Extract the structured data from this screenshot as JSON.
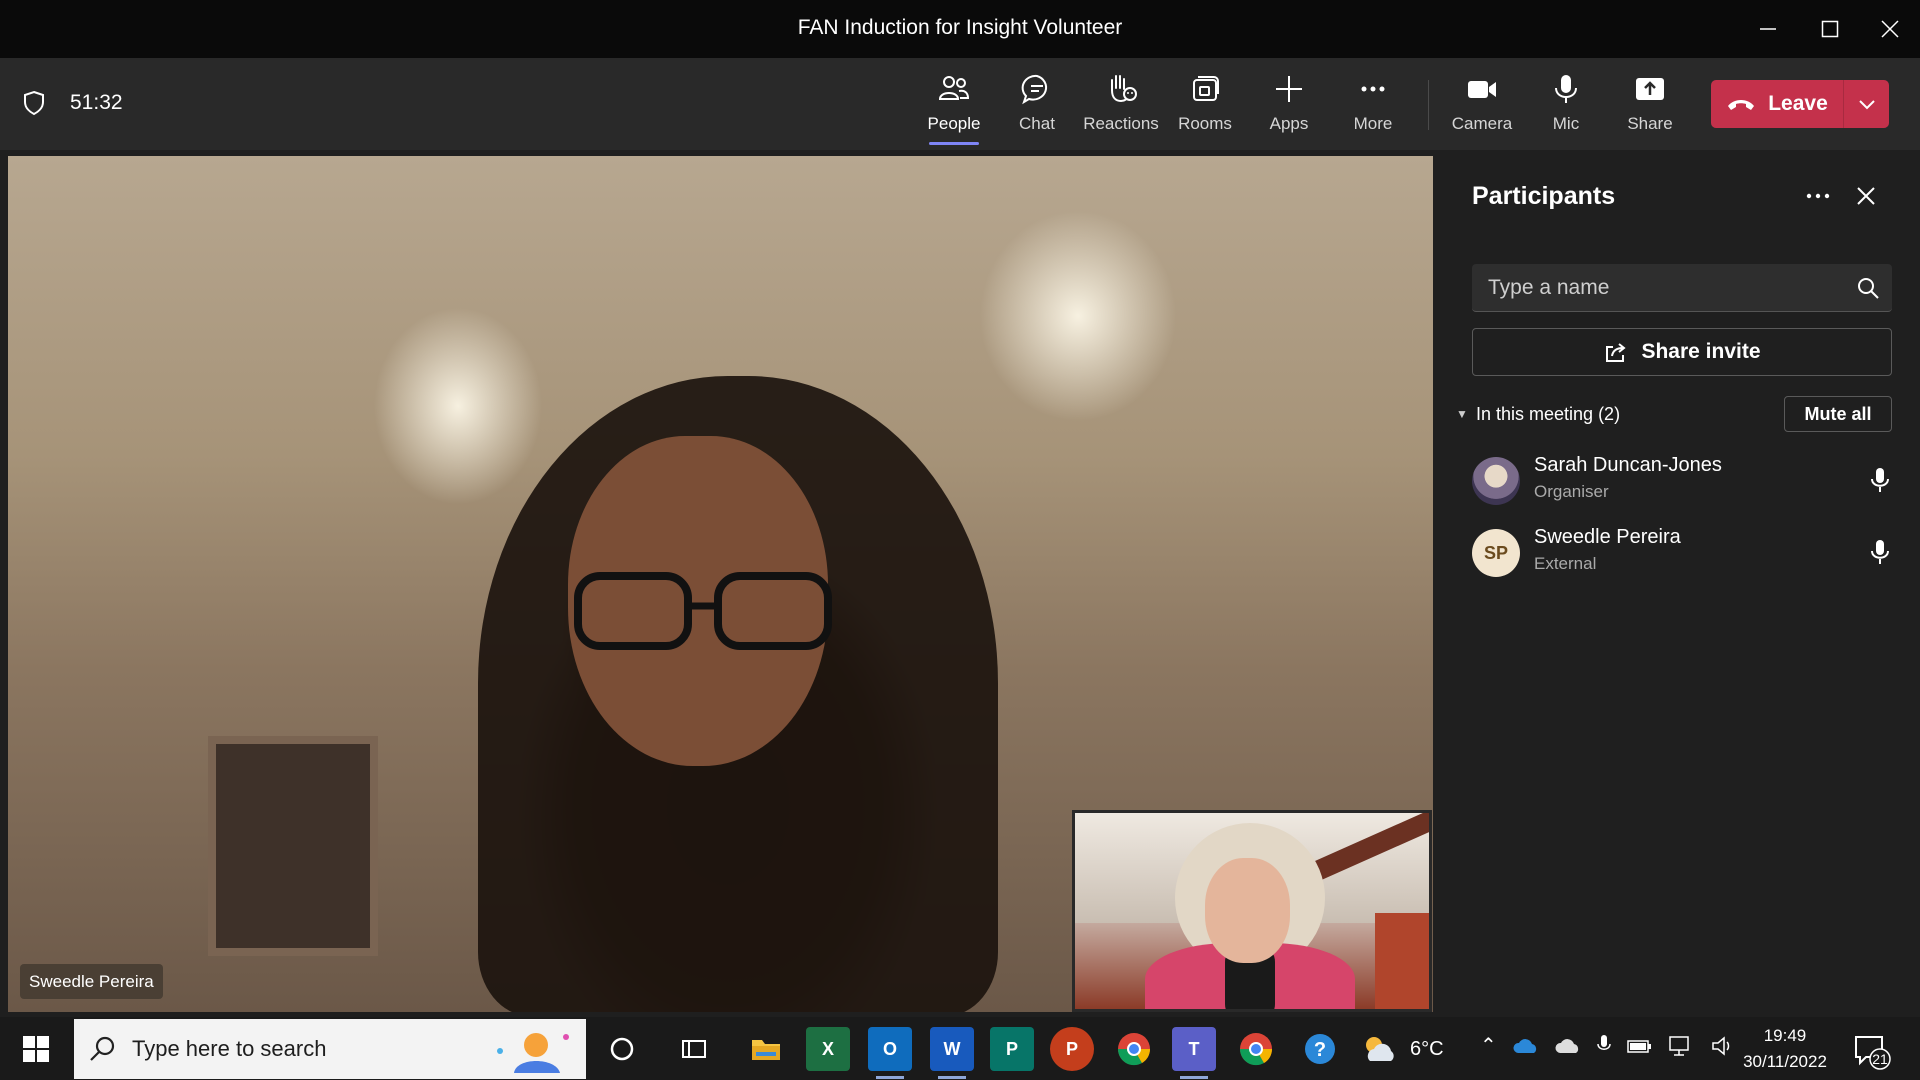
{
  "window": {
    "title": "FAN Induction for Insight Volunteer"
  },
  "toolbar": {
    "timer": "51:32",
    "buttons": [
      {
        "id": "people",
        "label": "People",
        "icon": "people-icon",
        "active": true
      },
      {
        "id": "chat",
        "label": "Chat",
        "icon": "chat-icon"
      },
      {
        "id": "reactions",
        "label": "Reactions",
        "icon": "raise-hand-icon"
      },
      {
        "id": "rooms",
        "label": "Rooms",
        "icon": "rooms-icon"
      },
      {
        "id": "apps",
        "label": "Apps",
        "icon": "plus-icon"
      },
      {
        "id": "more",
        "label": "More",
        "icon": "more-icon"
      },
      {
        "id": "camera",
        "label": "Camera",
        "icon": "camera-icon"
      },
      {
        "id": "mic",
        "label": "Mic",
        "icon": "mic-icon"
      },
      {
        "id": "share",
        "label": "Share",
        "icon": "share-tray-icon"
      }
    ],
    "leave_label": "Leave",
    "leave_color": "#c4314b"
  },
  "stage": {
    "main_name": "Sweedle Pereira"
  },
  "participants": {
    "title": "Participants",
    "search_placeholder": "Type a name",
    "share_invite": "Share invite",
    "section_label": "In this meeting (2)",
    "mute_all": "Mute all",
    "people": [
      {
        "name": "Sarah Duncan-Jones",
        "role": "Organiser",
        "avatar": "photo"
      },
      {
        "name": "Sweedle Pereira",
        "role": "External",
        "avatar": "initials",
        "initials": "SP"
      }
    ]
  },
  "taskbar": {
    "search_placeholder": "Type here to search",
    "apps": [
      {
        "name": "cortana-icon"
      },
      {
        "name": "task-view-icon"
      },
      {
        "name": "file-explorer-icon"
      },
      {
        "name": "excel-icon",
        "letter": "X",
        "color": "#1d6f42"
      },
      {
        "name": "outlook-icon",
        "letter": "O",
        "color": "#0f6cbd"
      },
      {
        "name": "word-icon",
        "letter": "W",
        "color": "#185abd"
      },
      {
        "name": "publisher-icon",
        "letter": "P",
        "color": "#077568"
      },
      {
        "name": "powerpoint-icon",
        "letter": "P",
        "color": "#c43e1c"
      },
      {
        "name": "chrome-icon"
      },
      {
        "name": "teams-icon",
        "letter": "T",
        "color": "#5b5fc7"
      },
      {
        "name": "chrome-profile-icon"
      },
      {
        "name": "help-icon"
      }
    ],
    "weather": "6°C",
    "time": "19:49",
    "date": "30/11/2022",
    "notifications": "21"
  }
}
